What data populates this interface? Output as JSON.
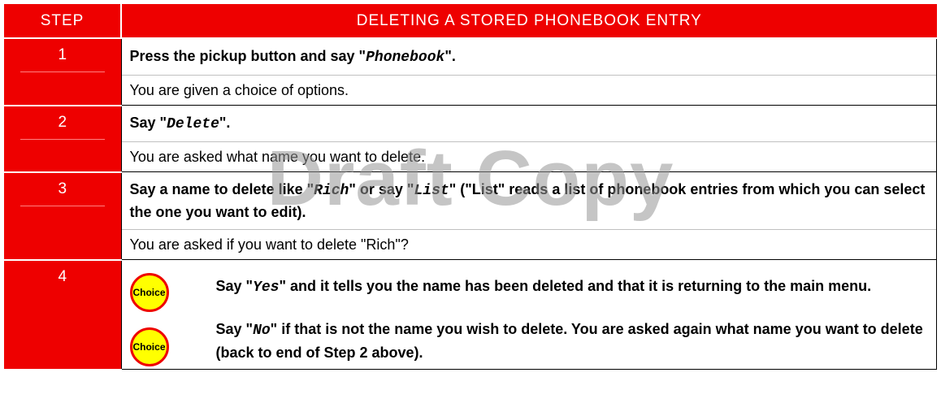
{
  "header": {
    "step": "STEP",
    "title": "DELETING A STORED PHONEBOOK ENTRY"
  },
  "steps": [
    {
      "num": "1",
      "action_pre": "Press the pickup button and say \"",
      "action_cmd": "Phonebook",
      "action_post": "\".",
      "result": "You are given a choice of options."
    },
    {
      "num": "2",
      "action_pre": "Say \"",
      "action_cmd": "Delete",
      "action_post": "\".",
      "result": "You are asked what name you want to delete."
    },
    {
      "num": "3",
      "action_pre": "Say a name to delete like \"",
      "action_cmd": "Rich",
      "action_mid": "\" or say \"",
      "action_cmd2": "List",
      "action_post": "\" (\"List\" reads a list of phonebook entries from which you can select the one you want to edit).",
      "result": "You are asked if you want to delete \"Rich\"?"
    },
    {
      "num": "4",
      "choices": [
        {
          "badge": "Choice",
          "pre": "Say \"",
          "cmd": "Yes",
          "post": "\" and it tells you the name has been deleted and that it is returning to the main menu."
        },
        {
          "badge": "Choice",
          "pre": "Say \"",
          "cmd": "No",
          "post": "\" if that is not the name you wish to delete. You are asked again what name you want to delete (back to end of Step 2 above)."
        }
      ]
    }
  ],
  "watermark": "Draft Copy",
  "colors": {
    "accent": "#ee0000",
    "badge_fill": "#ffff00"
  }
}
